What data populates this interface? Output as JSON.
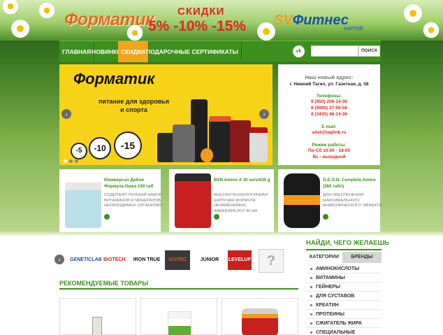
{
  "header": {
    "logo": "Форматик",
    "promo_title": "СКИДКИ",
    "promo_values": "5% -10% -15%",
    "fitness_prefix": "SV",
    "fitness_name": "Фитнес",
    "fitness_sub": "КАРТОЙ"
  },
  "nav": {
    "items": [
      {
        "label": "ГЛАВНАЯ"
      },
      {
        "label": "НОВИНКИ"
      },
      {
        "label": "СКИДКИ"
      },
      {
        "label": "ПОДАРОЧНЫЕ СЕРТИФИКАТЫ"
      }
    ],
    "vk_label": "vk",
    "search_placeholder": "",
    "search_button": "ПОИСК"
  },
  "slider": {
    "logo": "Форматик",
    "subtitle_line1": "питание для здоровья",
    "subtitle_line2": "и спорта",
    "discounts": [
      "-5",
      "-10",
      "-15"
    ]
  },
  "address": {
    "title": "Наш новый адрес:",
    "street": "г. Нижний Тагил, ул. Газетная, д. 58",
    "phones_title": "Телефоны:",
    "phones": [
      "8 (950) 206-14-36",
      "8 (9000) 37-56-56",
      "8 (3435) 46-14-36"
    ],
    "email_title": "E-mail:",
    "email": "atlet@taglink.ru",
    "hours_title": "Режим работы:",
    "hours": "Пн-Сб 10:00 - 18:00",
    "day_off": "Вс - выходной"
  },
  "products": [
    {
      "name": "Юниверсал Дейли Формула Ошка 100 таб",
      "desc": "СОДЕРЖИТ ПОЛНЫЙ НАБОР ВИТАМИНОВ И МИНЕРАЛОВ, НЕОБХОДИМЫХ ОРГАНИЗМУ"
    },
    {
      "name": "BSN Amino-X 30 serv/435 g",
      "desc": "ВЫСОКОТЕХНОЛОГИЧНАЯ ШИПУЧАЯ ФОРМУЛА НЕЗАМЕНИМЫХ АМИНОКИСЛОТ BCAA"
    },
    {
      "name": "G.E.O.N. Complete Amino (360 табл)",
      "desc": "ДЛЯ ОБЕСПЕЧЕНИЯ МАКСИМАЛЬНОГО АНАБОЛИЧЕСКОГО ЭФФЕКТА"
    }
  ],
  "brands": [
    "GENETICLAB",
    "BIOTECH",
    "IRON TRUE",
    "SCITEC",
    "JUNIOR",
    "LEVELUP",
    "?"
  ],
  "recommended_title": "РЕКОМЕНДУЕМЫЕ ТОВАРЫ",
  "sidebar": {
    "find_title": "НАЙДИ, ЧЕГО ЖЕЛАЕШЬ",
    "tabs": [
      "КАТЕГОРИИ",
      "БРЕНДЫ"
    ],
    "categories": [
      "АМИНОКИСЛОТЫ",
      "ВИТАМИНЫ",
      "ГЕЙНЕРЫ",
      "ДЛЯ СУСТАВОВ",
      "КРЕАТИН",
      "ПРОТЕИНЫ",
      "СЖИГАТЕЛЬ ЖИРА",
      "СПЕЦИАЛЬНЫЕ"
    ]
  },
  "colors": {
    "accent": "#3d8f1e",
    "nav_active": "#f2a41c",
    "promo": "#e2261f",
    "slider_bg": "#f7d317"
  }
}
